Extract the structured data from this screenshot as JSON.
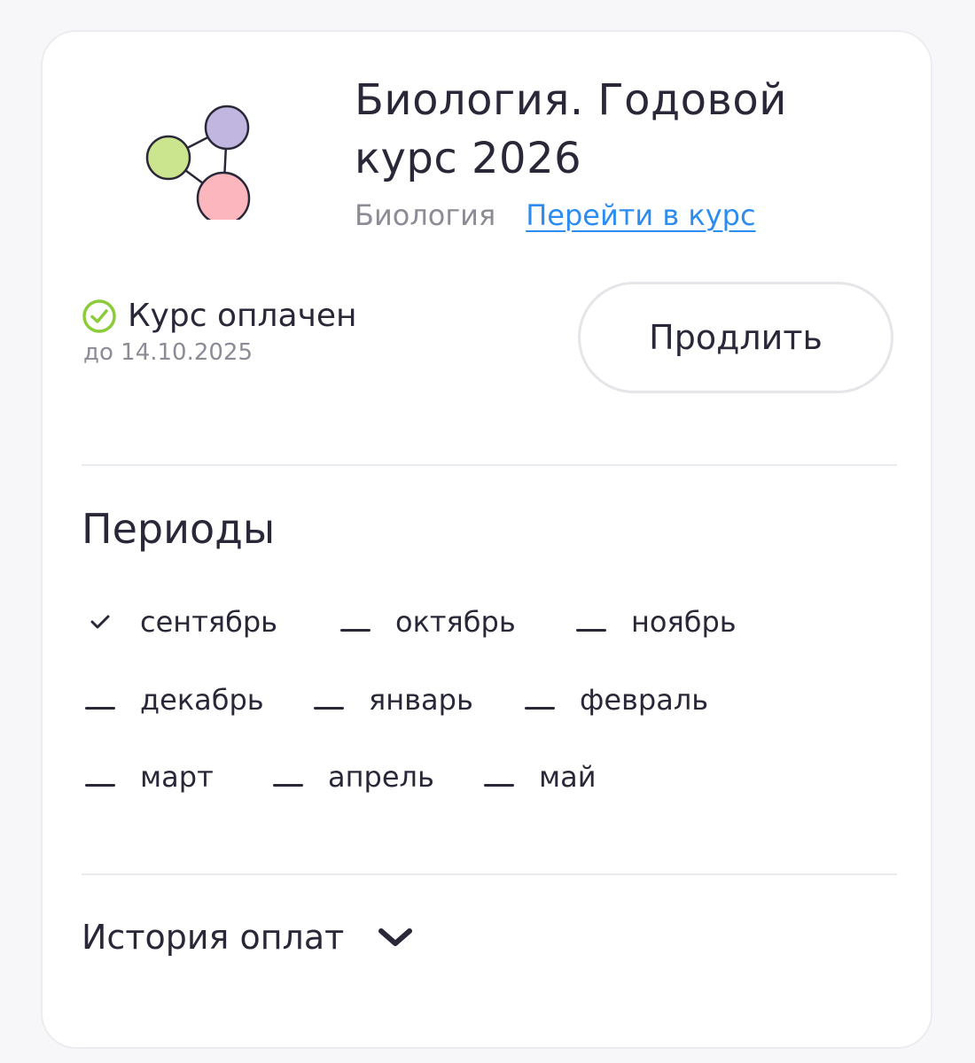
{
  "course": {
    "title": "Биология. Годовой курс 2026",
    "subject": "Биология",
    "go_to_course_link": "Перейти в курс",
    "logo_icon": "molecule-icon"
  },
  "status": {
    "icon": "check-circle-icon",
    "label": "Курс оплачен",
    "paid_until": "до 14.10.2025",
    "accent_color": "#8ccc3a"
  },
  "actions": {
    "extend_label": "Продлить"
  },
  "periods": {
    "heading": "Периоды",
    "items": [
      {
        "label": "сентябрь",
        "state": "completed"
      },
      {
        "label": "октябрь",
        "state": "pending"
      },
      {
        "label": "ноябрь",
        "state": "pending"
      },
      {
        "label": "декабрь",
        "state": "pending"
      },
      {
        "label": "январь",
        "state": "pending"
      },
      {
        "label": "февраль",
        "state": "pending"
      },
      {
        "label": "март",
        "state": "pending"
      },
      {
        "label": "апрель",
        "state": "pending"
      },
      {
        "label": "май",
        "state": "pending"
      }
    ]
  },
  "history": {
    "label": "История оплат",
    "icon": "chevron-down-icon"
  },
  "colors": {
    "link": "#2d8cf0",
    "text": "#2a2838",
    "muted": "#8c8b96"
  }
}
